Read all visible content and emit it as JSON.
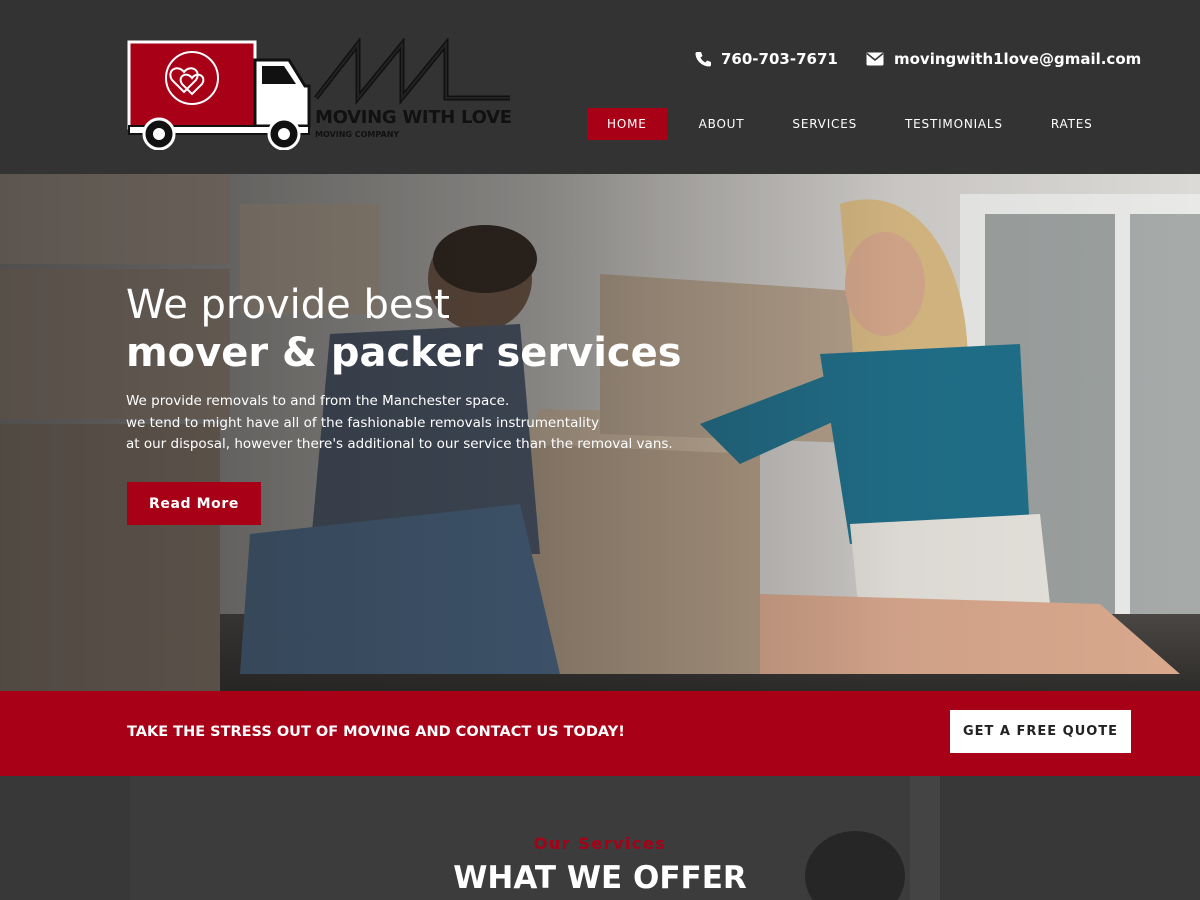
{
  "brand": {
    "logo_monogram": "MWL",
    "logo_name_1": "MOVING",
    "logo_name_2": "WITH LOVE",
    "logo_tagline": "MOVING COMPANY",
    "color_accent": "#a80016",
    "color_header": "#333333"
  },
  "contact": {
    "phone": "760-703-7671",
    "phone_icon": "phone-icon",
    "email": "movingwith1love@gmail.com",
    "email_icon": "envelope-icon"
  },
  "nav": {
    "items": [
      {
        "label": "HOME",
        "active": true
      },
      {
        "label": "ABOUT",
        "active": false
      },
      {
        "label": "SERVICES",
        "active": false
      },
      {
        "label": "TESTIMONIALS",
        "active": false
      },
      {
        "label": "RATES",
        "active": false
      }
    ]
  },
  "hero": {
    "title_line1": "We provide best",
    "title_bold": "mover & packer",
    "title_rest": " services",
    "desc_lines": [
      "We provide removals to and from the Manchester space.",
      "we tend to might have all of the fashionable removals instrumentality",
      "at our disposal, however there's additional to our service than the removal vans."
    ],
    "button_label": "Read More"
  },
  "cta": {
    "text": "TAKE THE STRESS OUT OF MOVING AND CONTACT US TODAY!",
    "button_label": "GET A FREE QUOTE"
  },
  "services": {
    "kicker": "Our Services",
    "title": "WHAT WE OFFER"
  }
}
